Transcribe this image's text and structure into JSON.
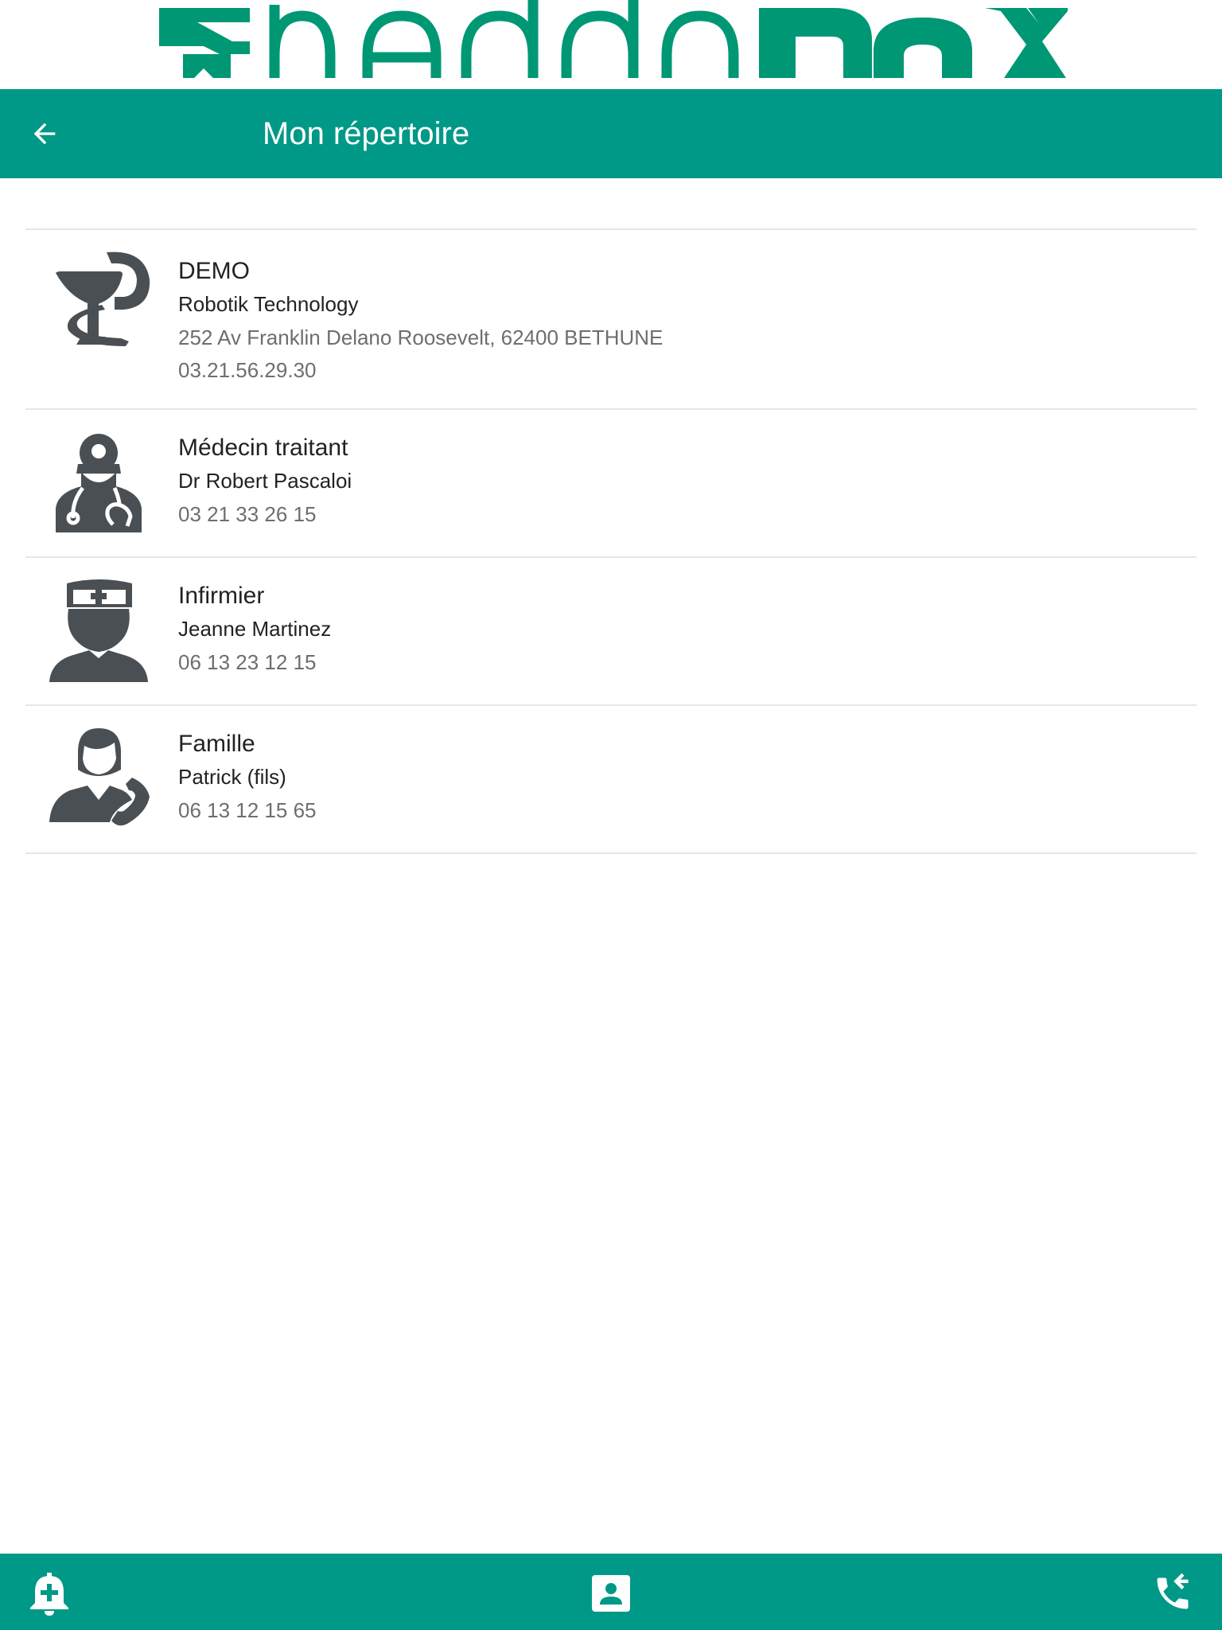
{
  "brand": {
    "logo_text": "hebdoBox",
    "color_primary": "#009886",
    "color_logo": "#009775",
    "color_icon": "#4a4f54"
  },
  "header": {
    "title": "Mon répertoire",
    "back_icon": "arrow-left-icon"
  },
  "contacts": [
    {
      "category": "DEMO",
      "icon": "pharmacy-bowl-snake-icon",
      "name": "Robotik Technology",
      "address": "252 Av Franklin Delano Roosevelt, 62400 BETHUNE",
      "phone": "03.21.56.29.30"
    },
    {
      "category": "Médecin traitant",
      "icon": "doctor-icon",
      "name": "Dr Robert Pascaloi",
      "phone": "03 21 33 26 15"
    },
    {
      "category": "Infirmier",
      "icon": "nurse-icon",
      "name": "Jeanne Martinez",
      "phone": "06 13 23 12 15"
    },
    {
      "category": "Famille",
      "icon": "family-phone-icon",
      "name": "Patrick (fils)",
      "phone": "06 13 12 15 65"
    }
  ],
  "bottom_nav": {
    "items": [
      {
        "icon": "medical-bell-icon"
      },
      {
        "icon": "contact-card-icon"
      },
      {
        "icon": "phone-callback-icon"
      }
    ]
  }
}
